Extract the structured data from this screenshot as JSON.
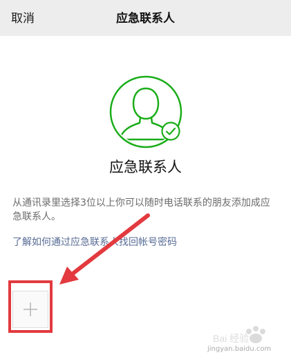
{
  "navbar": {
    "cancel_label": "取消",
    "title": "应急联系人"
  },
  "main": {
    "heading": "应急联系人",
    "description": "从通讯录里选择3位以上你可以随时电话联系的朋友添加成应急联系人。",
    "help_link": "了解如何通过应急联系人找回帐号密码"
  },
  "icons": {
    "avatar": "person-silhouette-icon",
    "badge": "check-circle-icon",
    "add": "plus-icon"
  },
  "colors": {
    "accent_green": "#1aad19",
    "link_blue": "#576b95",
    "annotation_red": "#e23a3f",
    "navbar_bg": "#ededed"
  },
  "watermark": {
    "brand": "Bai 经验",
    "url": "jingyan.baidu.com"
  }
}
